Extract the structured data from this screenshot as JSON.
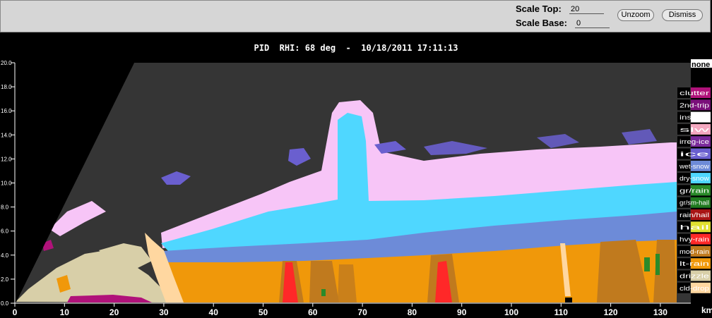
{
  "toolbar": {
    "scale_top_label": "Scale Top:",
    "scale_top_value": "20",
    "scale_base_label": "Scale Base:",
    "scale_base_value": "0",
    "unzoom_label": "Unzoom",
    "dismiss_label": "Dismiss"
  },
  "plot": {
    "title": "PID  RHI: 68 deg  -  10/18/2011 17:11:13",
    "x_unit": "km",
    "x_ticks": [
      "0",
      "10",
      "20",
      "30",
      "40",
      "50",
      "60",
      "70",
      "80",
      "90",
      "100",
      "110",
      "120",
      "130"
    ],
    "y_ticks": [
      "0.0",
      "2.0",
      "4.0",
      "6.0",
      "8.0",
      "10.0",
      "12.0",
      "14.0",
      "16.0",
      "18.0",
      "20.0"
    ]
  },
  "legend": {
    "header": "none",
    "items": [
      {
        "label": "clutter",
        "color": "#b0127a"
      },
      {
        "label": "2nd-trip",
        "color": "#7a0f7a"
      },
      {
        "label": "insects",
        "color": "#ffffff"
      },
      {
        "label": "slw",
        "color": "#f4a8c0"
      },
      {
        "label": "irreg-ice",
        "color": "#7a2a9a"
      },
      {
        "label": "ice",
        "color": "#6a5fcf"
      },
      {
        "label": "wet-snow",
        "color": "#6d8bd8"
      },
      {
        "label": "dry-snow",
        "color": "#4fd7ff"
      },
      {
        "label": "gr/rain",
        "color": "#2a8a2a"
      },
      {
        "label": "gr/sm-hail",
        "color": "#1f7a1f"
      },
      {
        "label": "rain/hail",
        "color": "#a81414"
      },
      {
        "label": "hail",
        "color": "#e0e030"
      },
      {
        "label": "hvy-rain",
        "color": "#ff2828"
      },
      {
        "label": "mod-rain",
        "color": "#c07a1e"
      },
      {
        "label": "lt-rain",
        "color": "#f0980a"
      },
      {
        "label": "drizzle",
        "color": "#d8cfa8"
      },
      {
        "label": "cld-drop",
        "color": "#ffd7a0"
      }
    ]
  }
}
